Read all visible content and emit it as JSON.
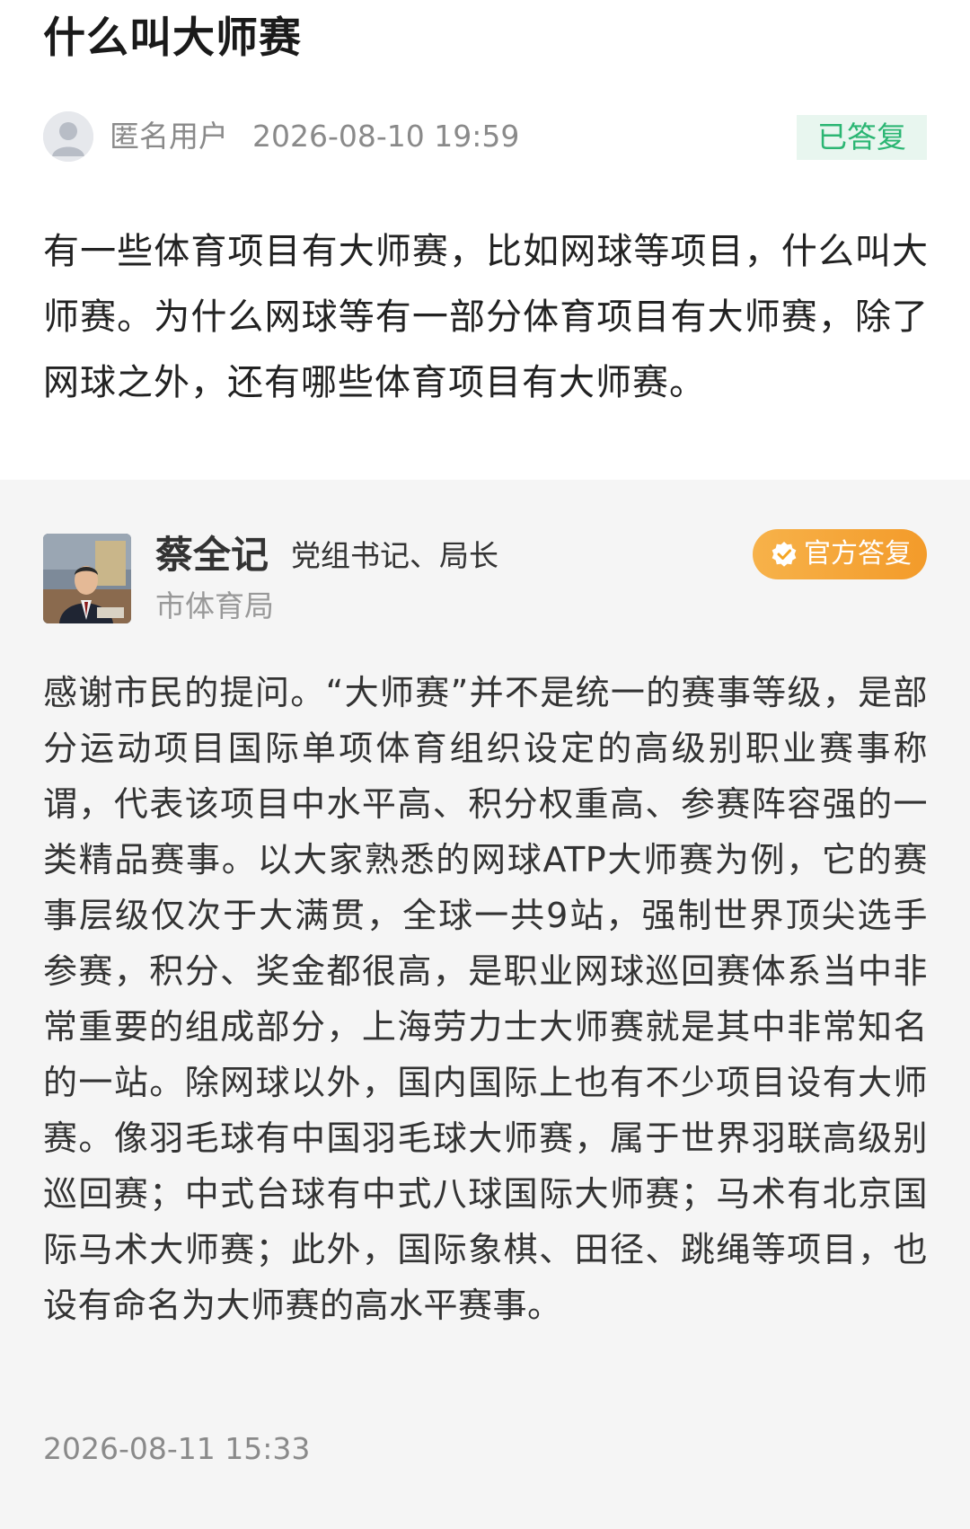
{
  "question": {
    "title": "什么叫大师赛",
    "user": "匿名用户",
    "time": "2026-08-10 19:59",
    "status": "已答复",
    "body": "有一些体育项目有大师赛，比如网球等项目，什么叫大师赛。为什么网球等有一部分体育项目有大师赛，除了网球之外，还有哪些体育项目有大师赛。"
  },
  "answer": {
    "official_name": "蔡全记",
    "official_title": "党组书记、局长",
    "department": "市体育局",
    "badge": "官方答复",
    "body": "感谢市民的提问。“大师赛”并不是统一的赛事等级，是部分运动项目国际单项体育组织设定的高级别职业赛事称谓，代表该项目中水平高、积分权重高、参赛阵容强的一类精品赛事。以大家熟悉的网球ATP大师赛为例，它的赛事层级仅次于大满贯，全球一共9站，强制世界顶尖选手参赛，积分、奖金都很高，是职业网球巡回赛体系当中非常重要的组成部分，上海劳力士大师赛就是其中非常知名的一站。除网球以外，国内国际上也有不少项目设有大师赛。像羽毛球有中国羽毛球大师赛，属于世界羽联高级别巡回赛；中式台球有中式八球国际大师赛；马术有北京国际马术大师赛；此外，国际象棋、田径、跳绳等项目，也设有命名为大师赛的高水平赛事。",
    "time": "2026-08-11 15:33"
  },
  "colors": {
    "status_green": "#2bb673",
    "status_bg": "#e8f6ef",
    "badge_orange": "#f5a623",
    "answer_bg": "#f5f5f5"
  },
  "icons": {
    "anonymous_avatar": "user-silhouette-icon",
    "badge_icon": "verified-check-icon"
  }
}
